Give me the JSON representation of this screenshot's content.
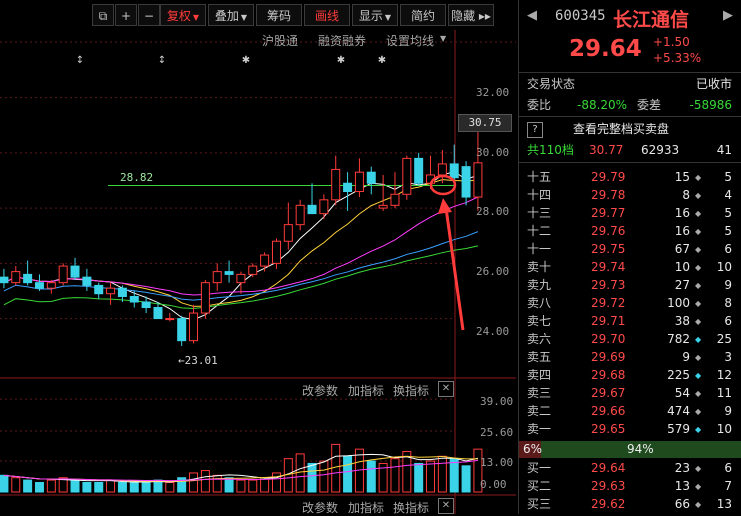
{
  "toolbar": {
    "buttons": [
      {
        "label": "⧉",
        "x": 0
      },
      {
        "label": "+",
        "x": 0
      },
      {
        "label": "−",
        "x": 0
      },
      {
        "label": "复权",
        "active": true
      },
      {
        "label": "叠加"
      },
      {
        "label": "筹码"
      },
      {
        "label": "画线",
        "active": true
      },
      {
        "label": "显示"
      },
      {
        "label": "简约"
      },
      {
        "label": "隐藏 ▸▸"
      }
    ]
  },
  "chart_header": {
    "links": [
      "沪股通",
      "融资融券",
      "设置均线"
    ]
  },
  "price_axis": {
    "ticks": [
      "32.00",
      "30.00",
      "28.00",
      "26.00",
      "24.00"
    ],
    "current_price_tag": "30.75"
  },
  "annotations": {
    "line_label": "28.82",
    "low_label": "←23.01"
  },
  "indicator_bar_1": {
    "labels": [
      "改参数",
      "加指标",
      "换指标"
    ],
    "close": "✕"
  },
  "indicator_bar_2": {
    "labels": [
      "改参数",
      "加指标",
      "换指标"
    ],
    "close": "✕"
  },
  "volume_axis": {
    "ticks": [
      "39.00",
      "25.60",
      "13.00",
      "0.00"
    ]
  },
  "chart_data": {
    "type": "candlestick",
    "price_ylim": [
      22.5,
      33
    ],
    "volume_ylim": [
      0,
      42
    ],
    "candles": [
      {
        "o": 25.5,
        "h": 25.8,
        "l": 25.1,
        "c": 25.3
      },
      {
        "o": 25.3,
        "h": 25.9,
        "l": 25.2,
        "c": 25.7
      },
      {
        "o": 25.6,
        "h": 26.1,
        "l": 25.2,
        "c": 25.3
      },
      {
        "o": 25.3,
        "h": 25.6,
        "l": 25.0,
        "c": 25.1
      },
      {
        "o": 25.1,
        "h": 25.4,
        "l": 24.9,
        "c": 25.3
      },
      {
        "o": 25.3,
        "h": 26.0,
        "l": 25.2,
        "c": 25.9
      },
      {
        "o": 25.9,
        "h": 26.2,
        "l": 25.4,
        "c": 25.5
      },
      {
        "o": 25.5,
        "h": 25.8,
        "l": 25.0,
        "c": 25.2
      },
      {
        "o": 25.2,
        "h": 25.3,
        "l": 24.7,
        "c": 24.9
      },
      {
        "o": 24.9,
        "h": 25.3,
        "l": 24.5,
        "c": 25.1
      },
      {
        "o": 25.1,
        "h": 25.2,
        "l": 24.6,
        "c": 24.8
      },
      {
        "o": 24.8,
        "h": 25.0,
        "l": 24.4,
        "c": 24.6
      },
      {
        "o": 24.6,
        "h": 24.8,
        "l": 24.2,
        "c": 24.4
      },
      {
        "o": 24.4,
        "h": 24.6,
        "l": 24.0,
        "c": 24.0
      },
      {
        "o": 24.0,
        "h": 24.2,
        "l": 23.9,
        "c": 24.0
      },
      {
        "o": 24.0,
        "h": 24.1,
        "l": 23.01,
        "c": 23.2
      },
      {
        "o": 23.2,
        "h": 24.5,
        "l": 23.1,
        "c": 24.2
      },
      {
        "o": 24.2,
        "h": 25.4,
        "l": 24.0,
        "c": 25.3
      },
      {
        "o": 25.3,
        "h": 26.0,
        "l": 25.0,
        "c": 25.7
      },
      {
        "o": 25.7,
        "h": 26.1,
        "l": 25.3,
        "c": 25.6
      },
      {
        "o": 25.3,
        "h": 25.7,
        "l": 24.9,
        "c": 25.6
      },
      {
        "o": 25.6,
        "h": 26.0,
        "l": 25.5,
        "c": 25.9
      },
      {
        "o": 25.9,
        "h": 26.4,
        "l": 25.7,
        "c": 26.3
      },
      {
        "o": 26.0,
        "h": 26.9,
        "l": 25.8,
        "c": 26.8
      },
      {
        "o": 26.8,
        "h": 28.2,
        "l": 26.5,
        "c": 27.4
      },
      {
        "o": 27.4,
        "h": 28.3,
        "l": 27.2,
        "c": 28.1
      },
      {
        "o": 28.1,
        "h": 28.9,
        "l": 27.8,
        "c": 27.8
      },
      {
        "o": 27.8,
        "h": 28.5,
        "l": 27.6,
        "c": 28.3
      },
      {
        "o": 28.3,
        "h": 29.9,
        "l": 28.1,
        "c": 29.4
      },
      {
        "o": 28.9,
        "h": 29.3,
        "l": 27.9,
        "c": 28.6
      },
      {
        "o": 28.6,
        "h": 29.8,
        "l": 28.4,
        "c": 29.3
      },
      {
        "o": 29.3,
        "h": 29.5,
        "l": 28.5,
        "c": 28.9
      },
      {
        "o": 28.0,
        "h": 29.2,
        "l": 27.9,
        "c": 28.1
      },
      {
        "o": 28.1,
        "h": 29.3,
        "l": 28.0,
        "c": 28.5
      },
      {
        "o": 28.5,
        "h": 29.9,
        "l": 28.3,
        "c": 29.8
      },
      {
        "o": 29.8,
        "h": 30.0,
        "l": 28.8,
        "c": 28.9
      },
      {
        "o": 28.9,
        "h": 29.9,
        "l": 28.7,
        "c": 29.2
      },
      {
        "o": 29.2,
        "h": 30.1,
        "l": 28.9,
        "c": 29.6
      },
      {
        "o": 29.6,
        "h": 30.3,
        "l": 28.7,
        "c": 29.1
      },
      {
        "o": 29.5,
        "h": 29.7,
        "l": 28.1,
        "c": 28.4
      },
      {
        "o": 28.4,
        "h": 30.75,
        "l": 27.9,
        "c": 29.64
      }
    ],
    "volumes": [
      7,
      6,
      5,
      4,
      5,
      6,
      5,
      4,
      4,
      5,
      4,
      4,
      4,
      5,
      4,
      6,
      8,
      9,
      7,
      6,
      5,
      5,
      6,
      8,
      14,
      16,
      12,
      13,
      20,
      15,
      18,
      13,
      12,
      14,
      17,
      12,
      13,
      15,
      14,
      11,
      18
    ],
    "line_28_82": 28.82
  },
  "panel": {
    "code": "600345",
    "name": "长江通信",
    "price": "29.64",
    "change": "+1.50",
    "change_pct": "+5.33%",
    "status_label": "交易状态",
    "status_value": "已收市",
    "weibi_label": "委比",
    "weibi_value": "-88.20%",
    "weicha_label": "委差",
    "weicha_value": "-58986",
    "q_mark": "?",
    "full_book": "查看完整档买卖盘",
    "total_label": "共110档",
    "total_price": "30.77",
    "total_vol": "62933",
    "total_cnt": "41",
    "asks": [
      {
        "l": "十五",
        "p": "29.79",
        "v": "15",
        "c": "5",
        "cy": false
      },
      {
        "l": "十四",
        "p": "29.78",
        "v": "8",
        "c": "4",
        "cy": false
      },
      {
        "l": "十三",
        "p": "29.77",
        "v": "16",
        "c": "5",
        "cy": false
      },
      {
        "l": "十二",
        "p": "29.76",
        "v": "16",
        "c": "5",
        "cy": false
      },
      {
        "l": "十一",
        "p": "29.75",
        "v": "67",
        "c": "6",
        "cy": false
      },
      {
        "l": "卖十",
        "p": "29.74",
        "v": "10",
        "c": "10",
        "cy": false
      },
      {
        "l": "卖九",
        "p": "29.73",
        "v": "27",
        "c": "9",
        "cy": false
      },
      {
        "l": "卖八",
        "p": "29.72",
        "v": "100",
        "c": "8",
        "cy": false
      },
      {
        "l": "卖七",
        "p": "29.71",
        "v": "38",
        "c": "6",
        "cy": false
      },
      {
        "l": "卖六",
        "p": "29.70",
        "v": "782",
        "c": "25",
        "cy": true
      },
      {
        "l": "卖五",
        "p": "29.69",
        "v": "9",
        "c": "3",
        "cy": false
      },
      {
        "l": "卖四",
        "p": "29.68",
        "v": "225",
        "c": "12",
        "cy": true
      },
      {
        "l": "卖三",
        "p": "29.67",
        "v": "54",
        "c": "11",
        "cy": false
      },
      {
        "l": "卖二",
        "p": "29.66",
        "v": "474",
        "c": "9",
        "cy": false
      },
      {
        "l": "卖一",
        "p": "29.65",
        "v": "579",
        "c": "10",
        "cy": true
      }
    ],
    "ratio_left": "6%",
    "ratio_mid": "94%",
    "bids": [
      {
        "l": "买一",
        "p": "29.64",
        "v": "23",
        "c": "6",
        "cy": false
      },
      {
        "l": "买二",
        "p": "29.63",
        "v": "13",
        "c": "7",
        "cy": false
      },
      {
        "l": "买三",
        "p": "29.62",
        "v": "66",
        "c": "13",
        "cy": false
      }
    ]
  }
}
